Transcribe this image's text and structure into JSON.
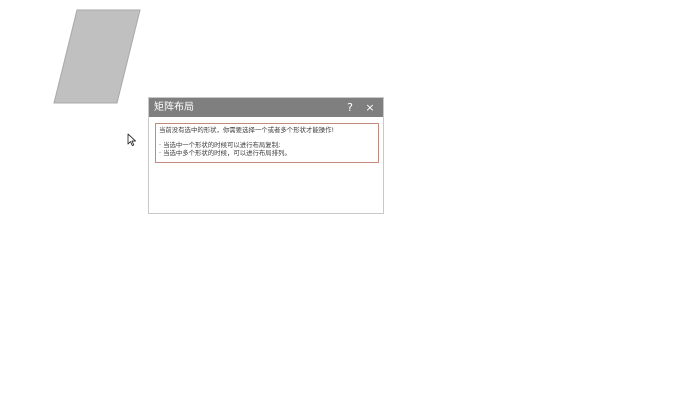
{
  "canvas": {
    "shape_name": "parallelogram",
    "shape_fill": "#c0c0c0",
    "shape_stroke": "#a8a8a8"
  },
  "dialog": {
    "title": "矩阵布局",
    "help_glyph": "?",
    "close_glyph": "×",
    "message": {
      "line1": "当前没有选中的形状，你需要选择一个或者多个形状才能操作!",
      "line2": "· 当选中一个形状的时候可以进行布局复制;",
      "line3": "· 当选中多个形状的时候，可以进行布局排列。"
    },
    "message_border_color": "#c08a7e"
  },
  "colors": {
    "titlebar_bg": "#7f7f7f",
    "titlebar_text": "#ffffff"
  }
}
